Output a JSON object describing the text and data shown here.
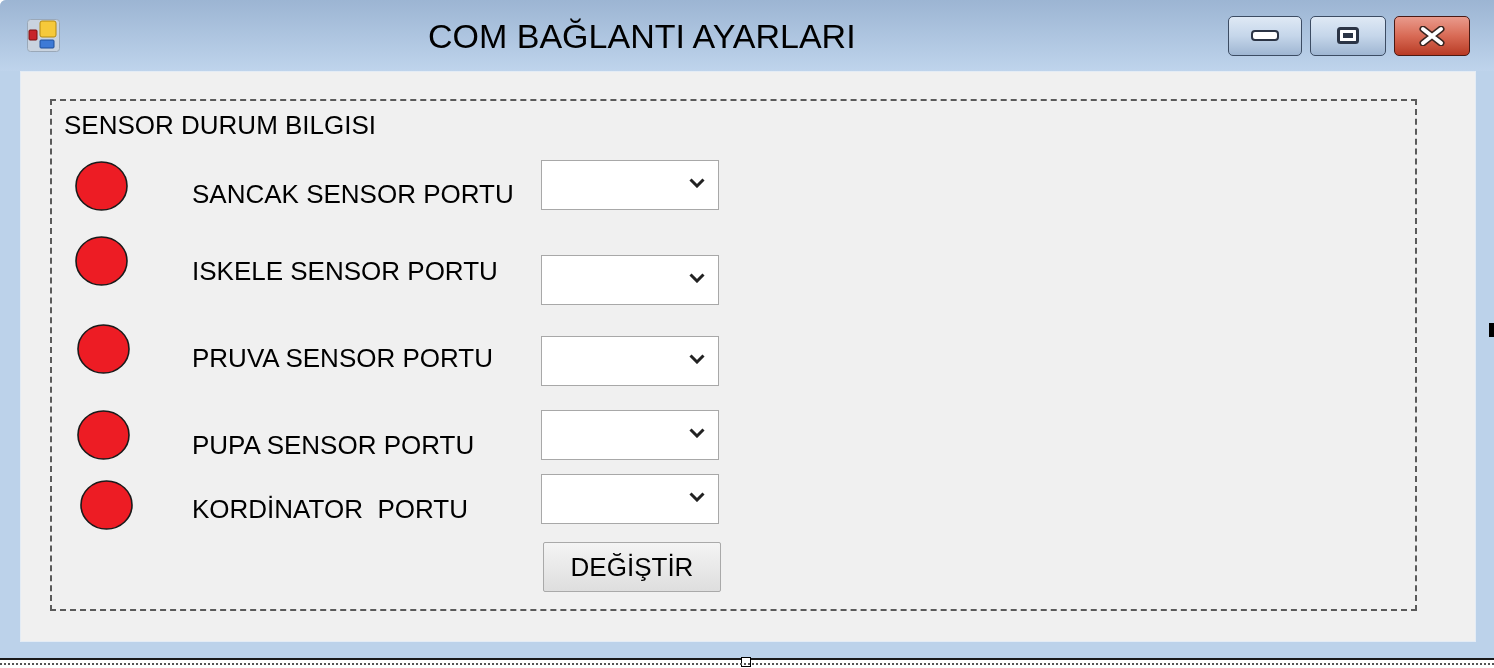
{
  "window": {
    "title": "COM BAĞLANTI AYARLARI"
  },
  "group": {
    "title": "SENSOR DURUM BILGISI",
    "sensors": [
      {
        "label": "SANCAK SENSOR PORTU",
        "color": "#ed1c24"
      },
      {
        "label": "ISKELE SENSOR PORTU",
        "color": "#ed1c24"
      },
      {
        "label": "PRUVA SENSOR PORTU",
        "color": "#ed1c24"
      },
      {
        "label": "PUPA SENSOR PORTU",
        "color": "#ed1c24"
      },
      {
        "label": "KORDİNATOR  PORTU",
        "color": "#ed1c24"
      }
    ],
    "button": {
      "label": "DEĞİŞTİR"
    }
  }
}
